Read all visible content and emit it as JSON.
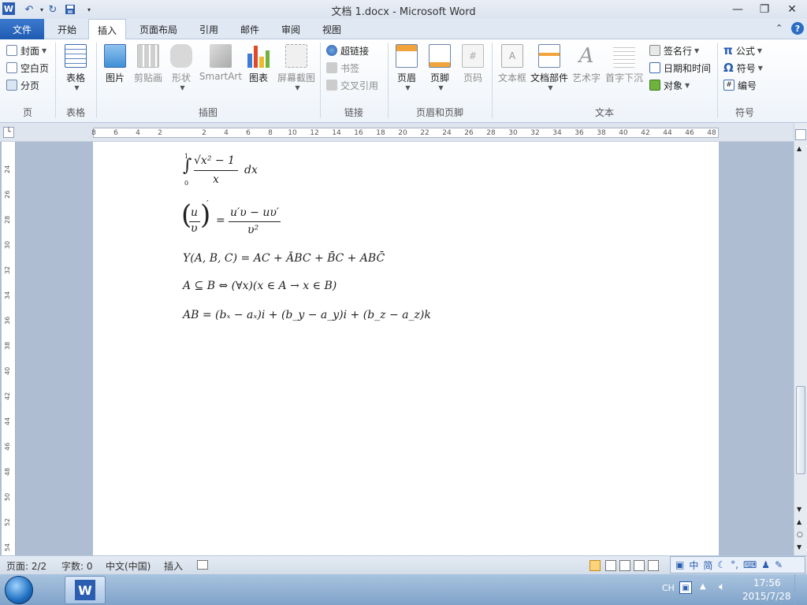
{
  "window": {
    "title": "文档 1.docx - Microsoft Word",
    "minimize_glyph": "—",
    "restore_glyph": "❐",
    "close_glyph": "✕"
  },
  "tabs": [
    {
      "label": "文件",
      "id": "file"
    },
    {
      "label": "开始",
      "id": "home"
    },
    {
      "label": "插入",
      "id": "insert",
      "active": true
    },
    {
      "label": "页面布局",
      "id": "page-layout"
    },
    {
      "label": "引用",
      "id": "references"
    },
    {
      "label": "邮件",
      "id": "mailings"
    },
    {
      "label": "审阅",
      "id": "review"
    },
    {
      "label": "视图",
      "id": "view"
    }
  ],
  "ribbon": {
    "pages": {
      "label": "页",
      "cover": "封面",
      "blank": "空白页",
      "break": "分页"
    },
    "tables": {
      "label": "表格",
      "table": "表格"
    },
    "illustrations": {
      "label": "插图",
      "picture": "图片",
      "clipart": "剪贴画",
      "shapes": "形状",
      "smartart": "SmartArt",
      "chart": "图表",
      "screenshot": "屏幕截图"
    },
    "links": {
      "label": "链接",
      "hyperlink": "超链接",
      "bookmark": "书签",
      "crossref": "交叉引用"
    },
    "header_footer": {
      "label": "页眉和页脚",
      "header": "页眉",
      "footer": "页脚",
      "pagenum": "页码"
    },
    "text": {
      "label": "文本",
      "textbox": "文本框",
      "quickparts": "文档部件",
      "wordart": "艺术字",
      "dropcap": "首字下沉",
      "signature": "签名行",
      "datetime": "日期和时间",
      "object": "对象"
    },
    "symbols": {
      "label": "符号",
      "equation": "公式",
      "symbol": "符号",
      "number": "编号"
    }
  },
  "ruler": {
    "ticks": [
      "8",
      "6",
      "4",
      "2",
      "",
      "2",
      "4",
      "6",
      "8",
      "10",
      "12",
      "14",
      "16",
      "18",
      "20",
      "22",
      "24",
      "26",
      "28",
      "30",
      "32",
      "34",
      "36",
      "38",
      "40",
      "42",
      "44",
      "46",
      "48"
    ],
    "vticks": [
      "24",
      "26",
      "28",
      "30",
      "32",
      "34",
      "36",
      "38",
      "40",
      "42",
      "44",
      "46",
      "48",
      "50",
      "52",
      "54"
    ]
  },
  "equations": {
    "integral_num": "√x² − 1",
    "integral_den": "x",
    "integral_dx": "dx",
    "integral_upper": "1",
    "integral_lower": "0",
    "deriv_left_num": "u",
    "deriv_left_den": "υ",
    "deriv_right_num": "u′υ − uυ′",
    "deriv_right_den": "υ²",
    "boolean": "Y(A, B, C) = AC + ĀBC + B̄C + ABC̄",
    "subset": "A ⊆ B  ⇔  (∀x)(x ∈ A → x ∈ B)",
    "vector": "AB = (bₓ − aₓ)i + (b_y − a_y)i + (b_z − a_z)k"
  },
  "status": {
    "page": "页面: 2/2",
    "words": "字数: 0",
    "language": "中文(中国)",
    "mode": "插入"
  },
  "ime": {
    "items": [
      "中",
      "简"
    ]
  },
  "taskbar": {
    "lang": "CH",
    "time": "17:56",
    "date": "2015/7/28"
  },
  "colors": {
    "accent": "#1e5bb0",
    "ribbon": "#eef3f9",
    "doc_bg": "#aebdd2"
  }
}
